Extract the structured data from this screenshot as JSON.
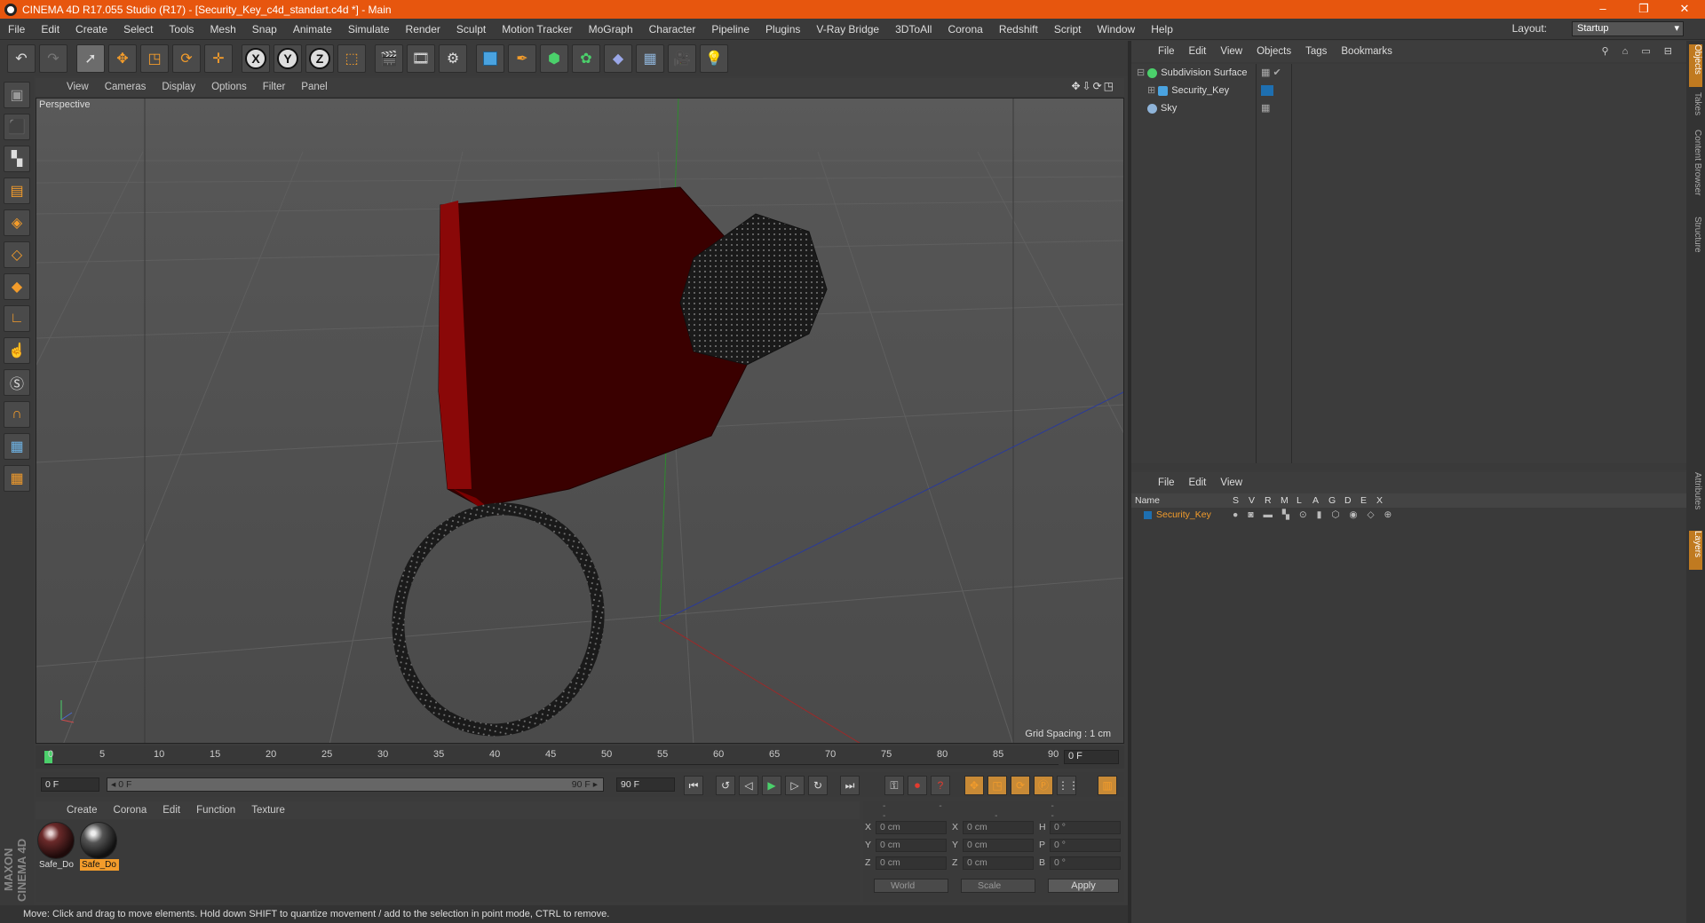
{
  "window": {
    "title": "CINEMA 4D R17.055 Studio (R17) - [Security_Key_c4d_standart.c4d *] - Main",
    "minimize": "–",
    "maximize": "❐",
    "close": "✕"
  },
  "menu": [
    "File",
    "Edit",
    "Create",
    "Select",
    "Tools",
    "Mesh",
    "Snap",
    "Animate",
    "Simulate",
    "Render",
    "Sculpt",
    "Motion Tracker",
    "MoGraph",
    "Character",
    "Pipeline",
    "Plugins",
    "V-Ray Bridge",
    "3DToAll",
    "Corona",
    "Redshift",
    "Script",
    "Window",
    "Help"
  ],
  "layout": {
    "label": "Layout:",
    "value": "Startup"
  },
  "viewport": {
    "menu": [
      "View",
      "Cameras",
      "Display",
      "Options",
      "Filter",
      "Panel"
    ],
    "name": "Perspective",
    "grid_spacing": "Grid Spacing : 1 cm",
    "nav_icons": "✥⇩⟳◳"
  },
  "timeline": {
    "ticks": [
      "0",
      "5",
      "10",
      "15",
      "20",
      "25",
      "30",
      "35",
      "40",
      "45",
      "50",
      "55",
      "60",
      "65",
      "70",
      "75",
      "80",
      "85",
      "90"
    ],
    "current": "0 F"
  },
  "controls": {
    "start": "0 F",
    "range_start": "◂ 0 F",
    "range_end": "90 F ▸",
    "end": "90 F"
  },
  "materials": {
    "menu": [
      "Create",
      "Corona",
      "Edit",
      "Function",
      "Texture"
    ],
    "items": [
      {
        "name": "Safe_Do"
      },
      {
        "name": "Safe_Do"
      }
    ]
  },
  "brand": "MAXON CINEMA 4D",
  "coords": {
    "header": "-- -- --",
    "rows": [
      {
        "a": "X",
        "v1": "0 cm",
        "b": "X",
        "v2": "0 cm",
        "c": "H",
        "v3": "0 °"
      },
      {
        "a": "Y",
        "v1": "0 cm",
        "b": "Y",
        "v2": "0 cm",
        "c": "P",
        "v3": "0 °"
      },
      {
        "a": "Z",
        "v1": "0 cm",
        "b": "Z",
        "v2": "0 cm",
        "c": "B",
        "v3": "0 °"
      }
    ],
    "world": "World",
    "scale": "Scale",
    "apply": "Apply"
  },
  "status": "Move: Click and drag to move elements. Hold down SHIFT to quantize movement / add to the selection in point mode, CTRL to remove.",
  "objects": {
    "menu": [
      "File",
      "Edit",
      "View",
      "Objects",
      "Tags",
      "Bookmarks"
    ],
    "icons": "⚲ ⌂ ▭ ⊟",
    "items": [
      {
        "name": "Subdivision Surface",
        "color": "#4bd06b"
      },
      {
        "name": "Security_Key",
        "color": "#4aa3e0"
      },
      {
        "name": "Sky",
        "color": "#8fb4d9"
      }
    ],
    "subd_tags": "▦ ✔"
  },
  "layers": {
    "menu": [
      "File",
      "Edit",
      "View"
    ],
    "columns": [
      "Name",
      "S",
      "V",
      "R",
      "M",
      "L",
      "A",
      "G",
      "D",
      "E",
      "X"
    ],
    "item": "Security_Key",
    "item_color": "#f39c2b",
    "flags": "● ◙ ▬ ▚ ⊙ ▮ ⬡ ◉ ◇ ⊕"
  },
  "side_tabs": [
    "Objects",
    "Takes",
    "Content Browser",
    "Structure",
    "Attributes",
    "Layers"
  ]
}
